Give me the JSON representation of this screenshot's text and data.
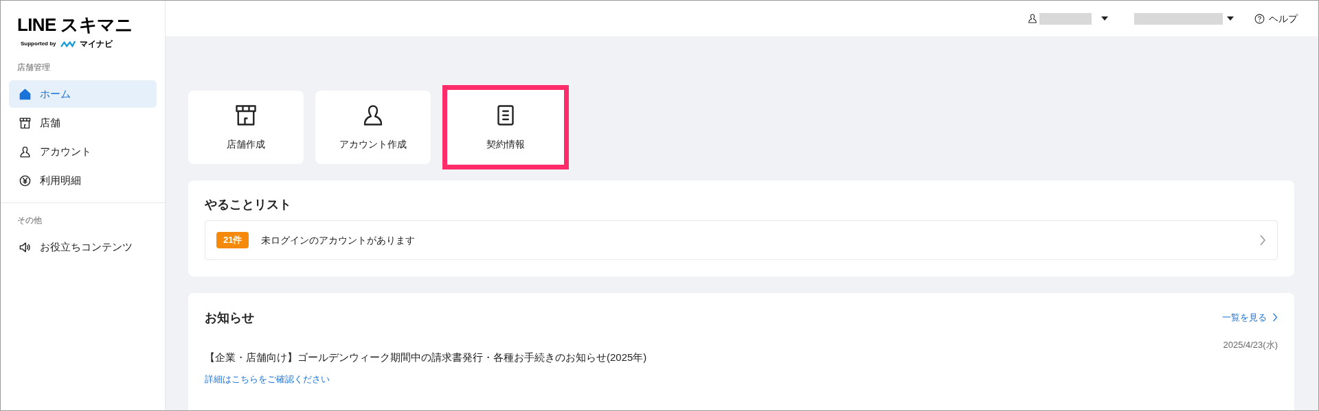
{
  "logo": {
    "title": "LINE スキマニ",
    "supported_by": "Supported by",
    "partner": "マイナビ"
  },
  "sidebar": {
    "sections": [
      {
        "label": "店舗管理",
        "items": [
          {
            "label": "ホーム",
            "kind": "home",
            "selected": true
          },
          {
            "label": "店舗",
            "kind": "store",
            "selected": false
          },
          {
            "label": "アカウント",
            "kind": "user",
            "selected": false
          },
          {
            "label": "利用明細",
            "kind": "yen",
            "selected": false
          }
        ]
      },
      {
        "label": "その他",
        "items": [
          {
            "label": "お役立ちコンテンツ",
            "kind": "speaker",
            "selected": false
          }
        ]
      }
    ]
  },
  "header": {
    "help": "ヘルプ"
  },
  "shortcuts": [
    {
      "label": "店舗作成",
      "kind": "store",
      "highlighted": false
    },
    {
      "label": "アカウント作成",
      "kind": "user",
      "highlighted": false
    },
    {
      "label": "契約情報",
      "kind": "document",
      "highlighted": true
    }
  ],
  "todo": {
    "title": "やることリスト",
    "items": [
      {
        "count": "21件",
        "text": "未ログインのアカウントがあります"
      }
    ]
  },
  "news": {
    "title": "お知らせ",
    "view_all": "一覧を見る",
    "items": [
      {
        "title": "【企業・店舗向け】ゴールデンウィーク期間中の請求書発行・各種お手続きのお知らせ(2025年)",
        "date": "2025/4/23(水)",
        "link": "詳細はこちらをご確認ください"
      }
    ]
  }
}
